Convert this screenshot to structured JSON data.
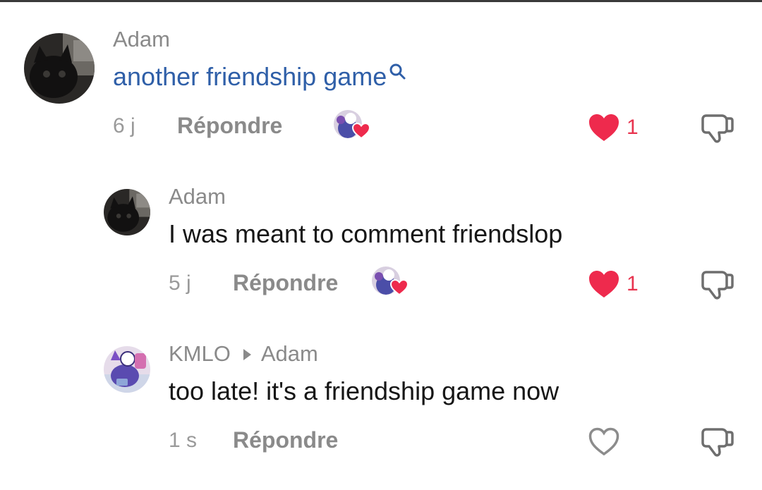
{
  "comments": [
    {
      "username": "Adam",
      "text": "another friendship game",
      "time": "6 j",
      "reply_label": "Répondre",
      "like_count": "1",
      "liked": true
    },
    {
      "username": "Adam",
      "text": "I was meant to comment friendslop",
      "time": "5 j",
      "reply_label": "Répondre",
      "like_count": "1",
      "liked": true
    },
    {
      "username": "KMLO",
      "reply_to": "Adam",
      "text": "too late! it's a friendship game now",
      "time": "1 s",
      "reply_label": "Répondre",
      "liked": false
    }
  ],
  "colors": {
    "link": "#2f5fa8",
    "heart": "#ee2a4d",
    "muted": "#8a8a8a"
  },
  "icons": [
    "search-icon",
    "heart-icon",
    "thumbs-down-icon",
    "avatar-black-cat",
    "avatar-purple-character"
  ]
}
